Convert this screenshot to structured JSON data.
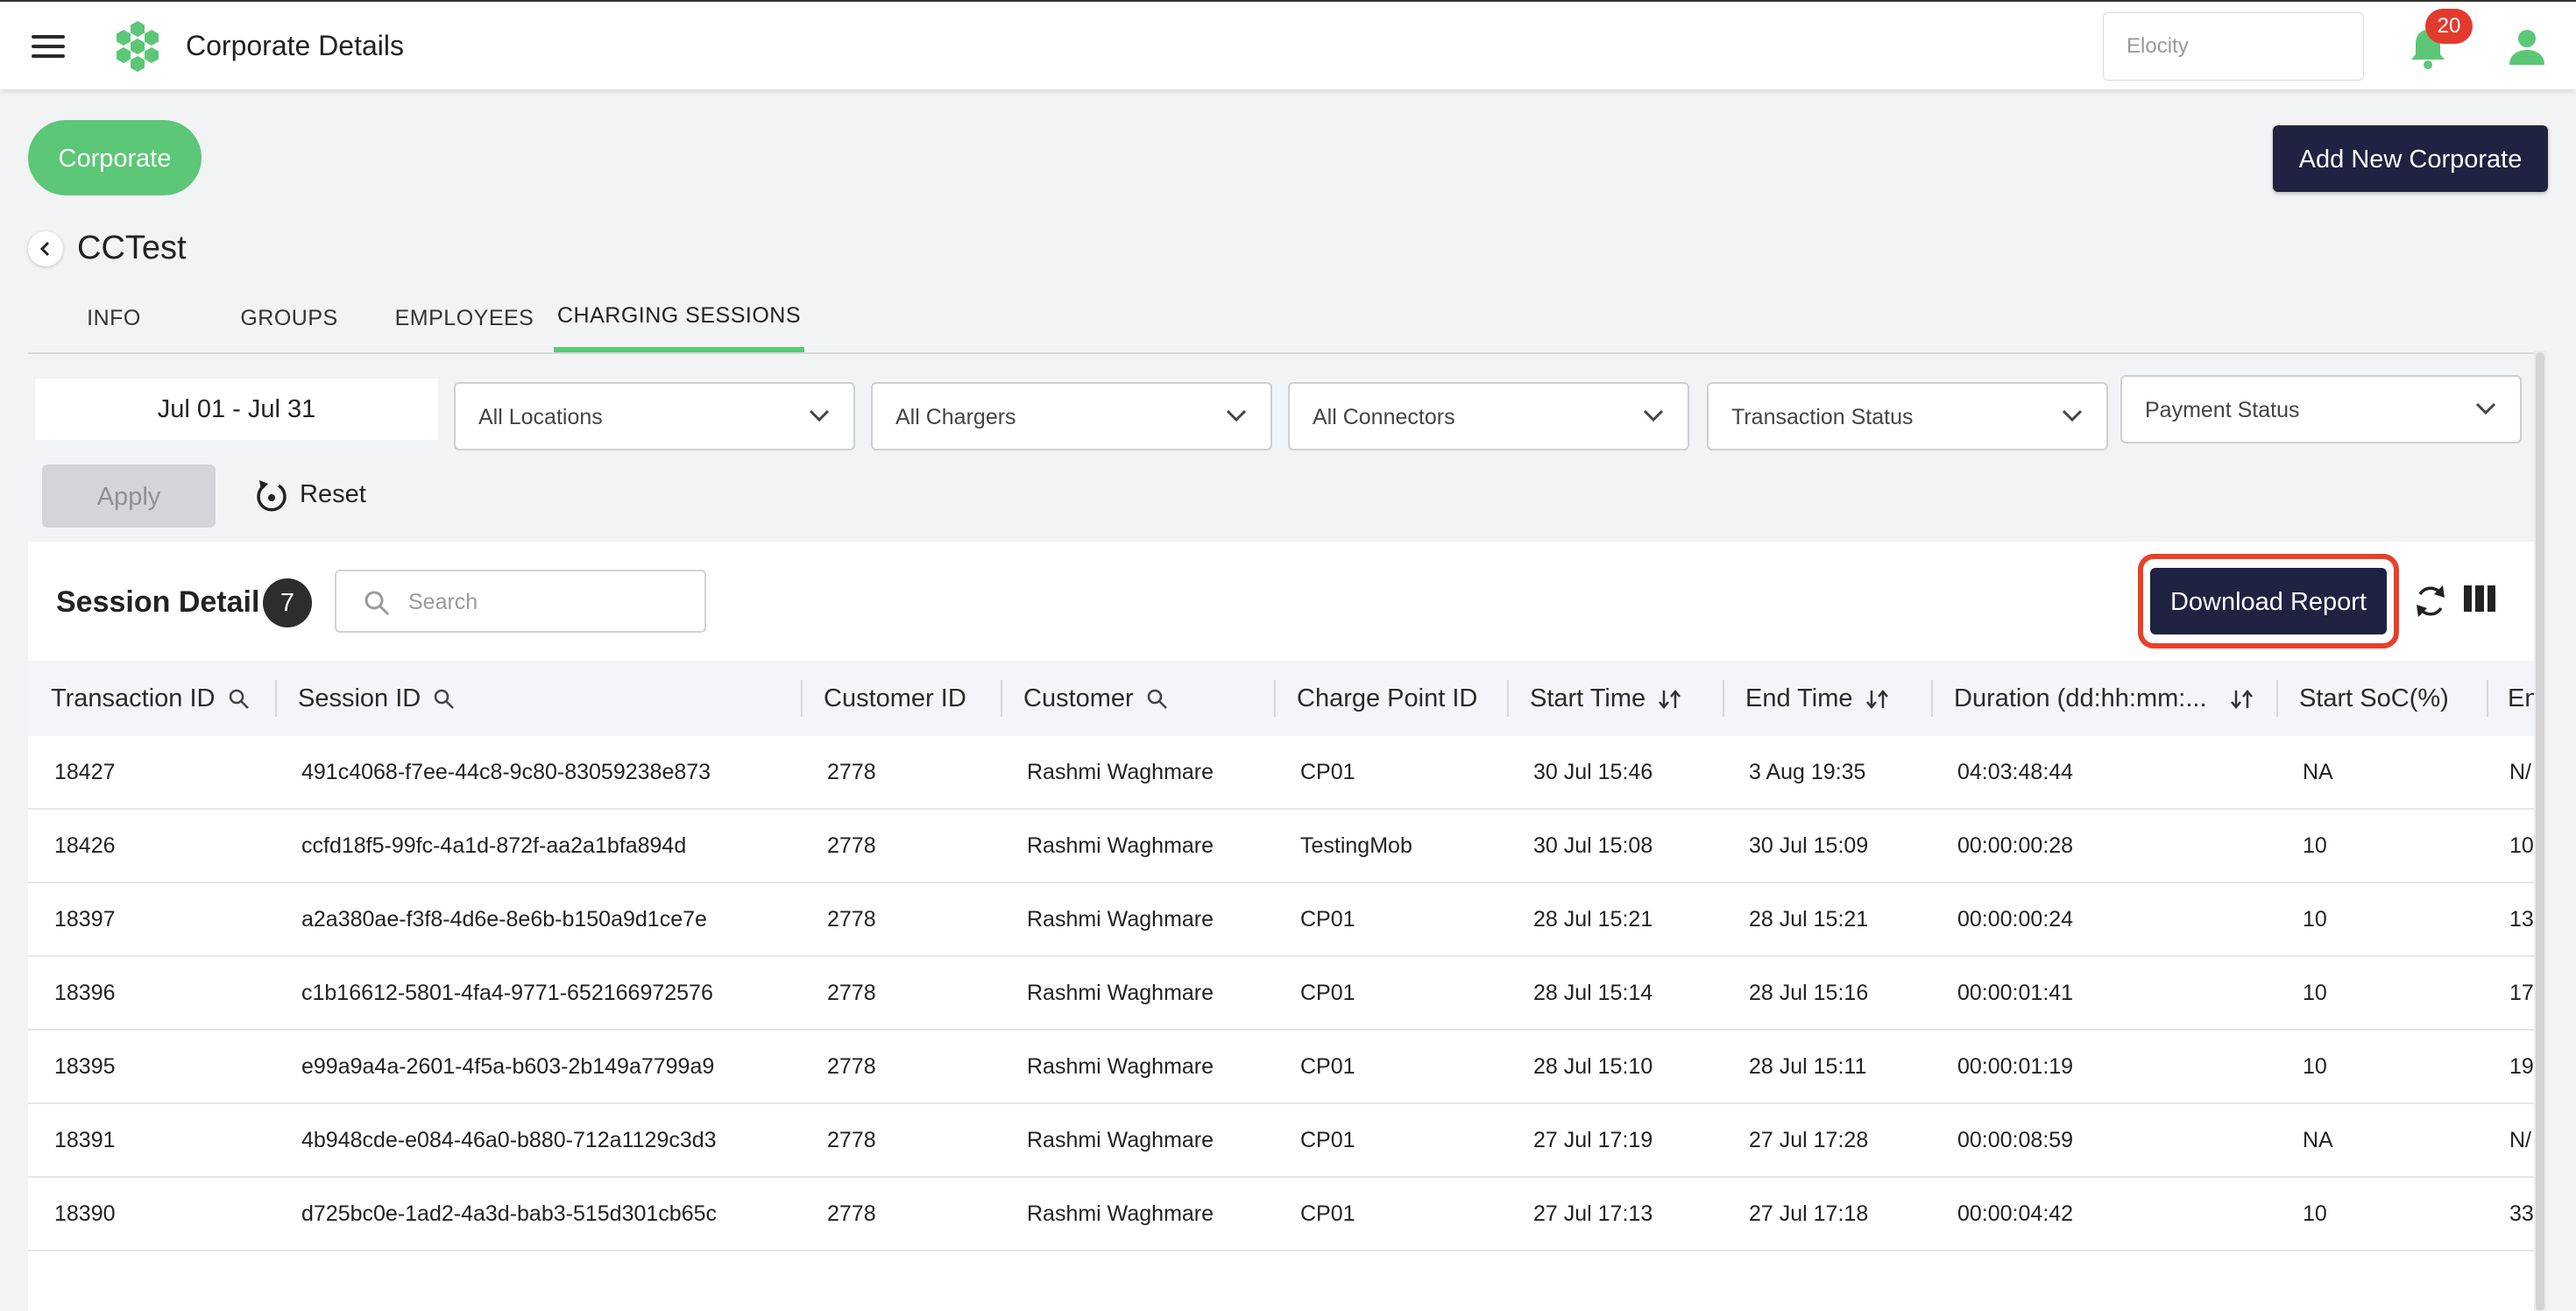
{
  "header": {
    "title": "Corporate Details",
    "org_placeholder": "Elocity",
    "notification_count": "20",
    "brand_color": "#5cc776",
    "dark_color": "#1f2241"
  },
  "top": {
    "corporate_label": "Corporate",
    "add_button_label": "Add New Corporate",
    "corporate_name": "CCTest"
  },
  "tabs": [
    {
      "label": "INFO",
      "active": false
    },
    {
      "label": "GROUPS",
      "active": false
    },
    {
      "label": "EMPLOYEES",
      "active": false
    },
    {
      "label": "CHARGING SESSIONS",
      "active": true
    }
  ],
  "filters": {
    "date_range": "Jul 01 - Jul 31",
    "locations": "All Locations",
    "chargers": "All Chargers",
    "connectors": "All Connectors",
    "transaction_status": "Transaction Status",
    "payment_status": "Payment Status",
    "apply_label": "Apply",
    "reset_label": "Reset"
  },
  "panel": {
    "title": "Session Detail",
    "count": "7",
    "search_placeholder": "Search",
    "download_label": "Download Report"
  },
  "table": {
    "columns": [
      {
        "label": "Transaction ID",
        "icon": "search-icon"
      },
      {
        "label": "Session ID",
        "icon": "search-icon"
      },
      {
        "label": "Customer ID",
        "icon": ""
      },
      {
        "label": "Customer",
        "icon": "search-icon"
      },
      {
        "label": "Charge Point ID",
        "icon": ""
      },
      {
        "label": "Start Time",
        "icon": "sort-icon"
      },
      {
        "label": "End Time",
        "icon": "sort-icon"
      },
      {
        "label": "Duration (dd:hh:mm:...",
        "icon": "sort-icon"
      },
      {
        "label": "Start SoC(%)",
        "icon": ""
      },
      {
        "label": "En",
        "icon": ""
      }
    ],
    "rows": [
      [
        "18427",
        "491c4068-f7ee-44c8-9c80-83059238e873",
        "2778",
        "Rashmi Waghmare",
        "CP01",
        "30 Jul 15:46",
        "3 Aug 19:35",
        "04:03:48:44",
        "NA",
        "N/"
      ],
      [
        "18426",
        "ccfd18f5-99fc-4a1d-872f-aa2a1bfa894d",
        "2778",
        "Rashmi Waghmare",
        "TestingMob",
        "30 Jul 15:08",
        "30 Jul 15:09",
        "00:00:00:28",
        "10",
        "10"
      ],
      [
        "18397",
        "a2a380ae-f3f8-4d6e-8e6b-b150a9d1ce7e",
        "2778",
        "Rashmi Waghmare",
        "CP01",
        "28 Jul 15:21",
        "28 Jul 15:21",
        "00:00:00:24",
        "10",
        "13"
      ],
      [
        "18396",
        "c1b16612-5801-4fa4-9771-652166972576",
        "2778",
        "Rashmi Waghmare",
        "CP01",
        "28 Jul 15:14",
        "28 Jul 15:16",
        "00:00:01:41",
        "10",
        "17"
      ],
      [
        "18395",
        "e99a9a4a-2601-4f5a-b603-2b149a7799a9",
        "2778",
        "Rashmi Waghmare",
        "CP01",
        "28 Jul 15:10",
        "28 Jul 15:11",
        "00:00:01:19",
        "10",
        "19"
      ],
      [
        "18391",
        "4b948cde-e084-46a0-b880-712a1129c3d3",
        "2778",
        "Rashmi Waghmare",
        "CP01",
        "27 Jul 17:19",
        "27 Jul 17:28",
        "00:00:08:59",
        "NA",
        "N/"
      ],
      [
        "18390",
        "d725bc0e-1ad2-4a3d-bab3-515d301cb65c",
        "2778",
        "Rashmi Waghmare",
        "CP01",
        "27 Jul 17:13",
        "27 Jul 17:18",
        "00:00:04:42",
        "10",
        "33"
      ]
    ]
  }
}
